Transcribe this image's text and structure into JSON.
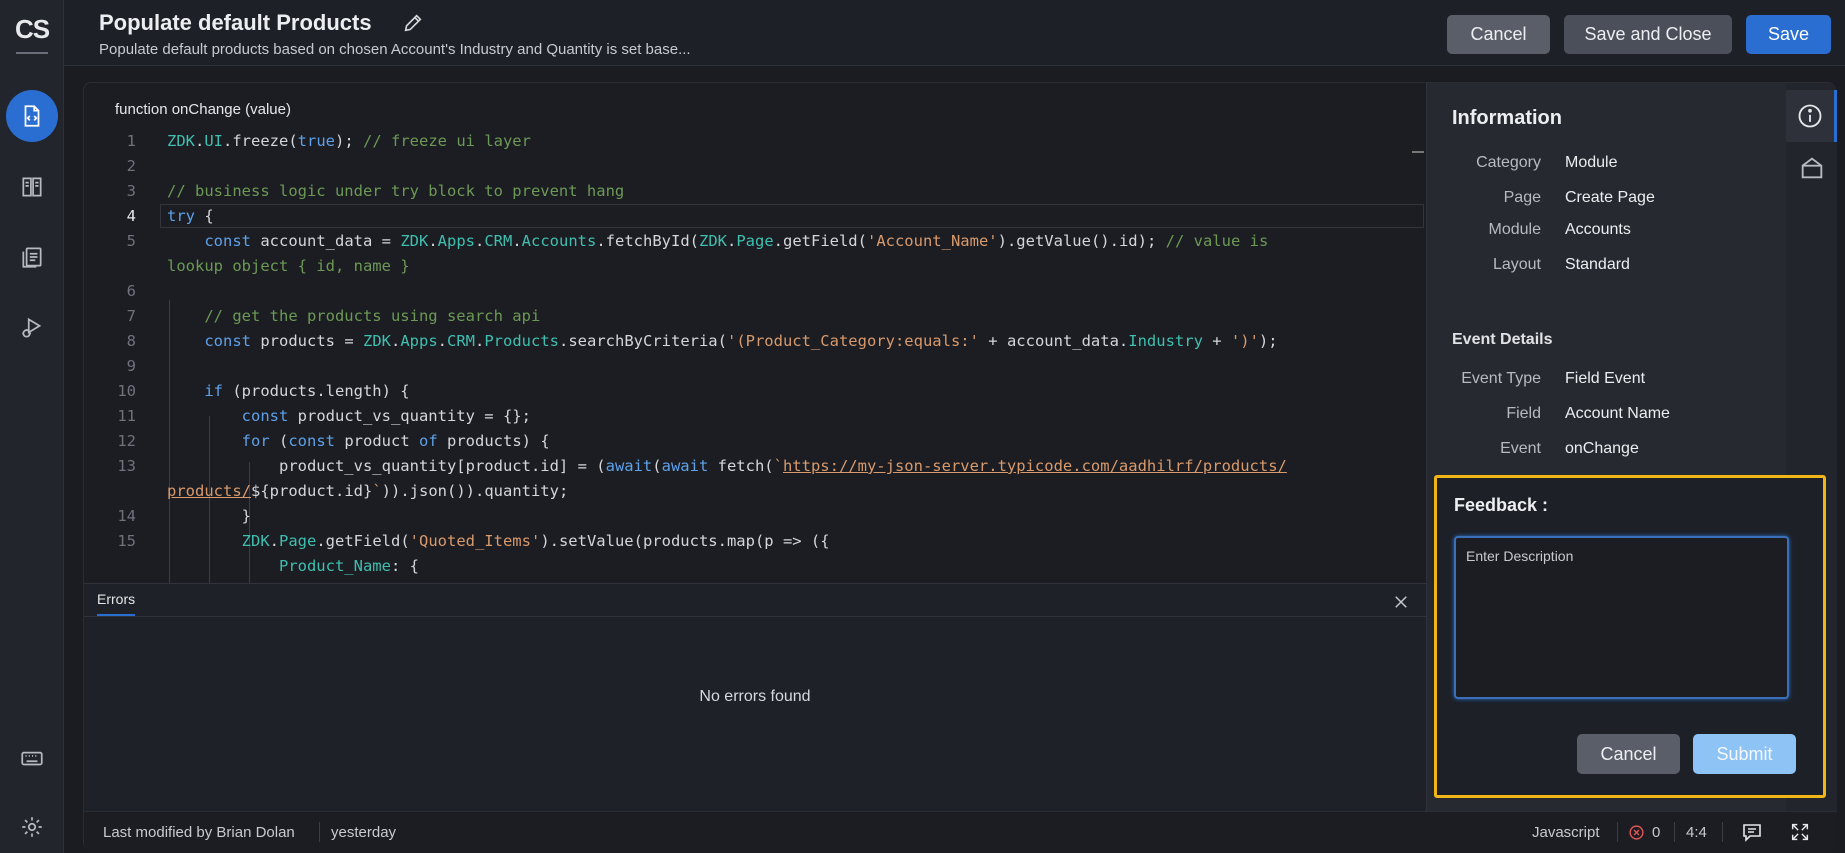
{
  "app": {
    "logo": "CS"
  },
  "rail": {
    "items": [
      {
        "icon": "code-file-icon",
        "active": true
      },
      {
        "icon": "book-icon",
        "active": false
      },
      {
        "icon": "documents-icon",
        "active": false
      },
      {
        "icon": "debug-run-icon",
        "active": false
      }
    ],
    "bottom": [
      {
        "icon": "keyboard-icon"
      },
      {
        "icon": "gear-icon"
      }
    ]
  },
  "header": {
    "title": "Populate default Products",
    "subtitle": "Populate default products based on chosen Account's Industry and Quantity is set base...",
    "cancel_label": "Cancel",
    "save_close_label": "Save and Close",
    "save_label": "Save"
  },
  "editor": {
    "signature": "function onChange (value)",
    "current_line": 4,
    "line_numbers": [
      "1",
      "2",
      "3",
      "4",
      "5",
      "",
      "6",
      "7",
      "8",
      "9",
      "10",
      "11",
      "12",
      "13",
      "",
      "14",
      "15",
      ""
    ]
  },
  "errors": {
    "tab_label": "Errors",
    "empty_message": "No errors found"
  },
  "footer": {
    "modified_by": "Last modified by Brian Dolan",
    "modified_when": "yesterday",
    "language": "Javascript",
    "error_count": "0",
    "cursor_pos": "4:4"
  },
  "info": {
    "title": "Information",
    "rows": [
      {
        "key": "Category",
        "value": "Module"
      },
      {
        "key": "Page",
        "value": "Create Page"
      },
      {
        "key": "Module",
        "value": "Accounts"
      },
      {
        "key": "Layout",
        "value": "Standard"
      }
    ],
    "event_title": "Event Details",
    "event_rows": [
      {
        "key": "Event Type",
        "value": "Field Event"
      },
      {
        "key": "Field",
        "value": "Account Name"
      },
      {
        "key": "Event",
        "value": "onChange"
      }
    ]
  },
  "side_tabs": [
    {
      "icon": "info-icon",
      "active": true
    },
    {
      "icon": "package-icon",
      "active": false
    }
  ],
  "feedback": {
    "title": "Feedback :",
    "placeholder": "Enter Description",
    "value": "",
    "cancel_label": "Cancel",
    "submit_label": "Submit"
  },
  "colors": {
    "accent": "#2a6ed1",
    "highlight": "#f2b518",
    "submit_disabled": "#8ec3f5"
  }
}
